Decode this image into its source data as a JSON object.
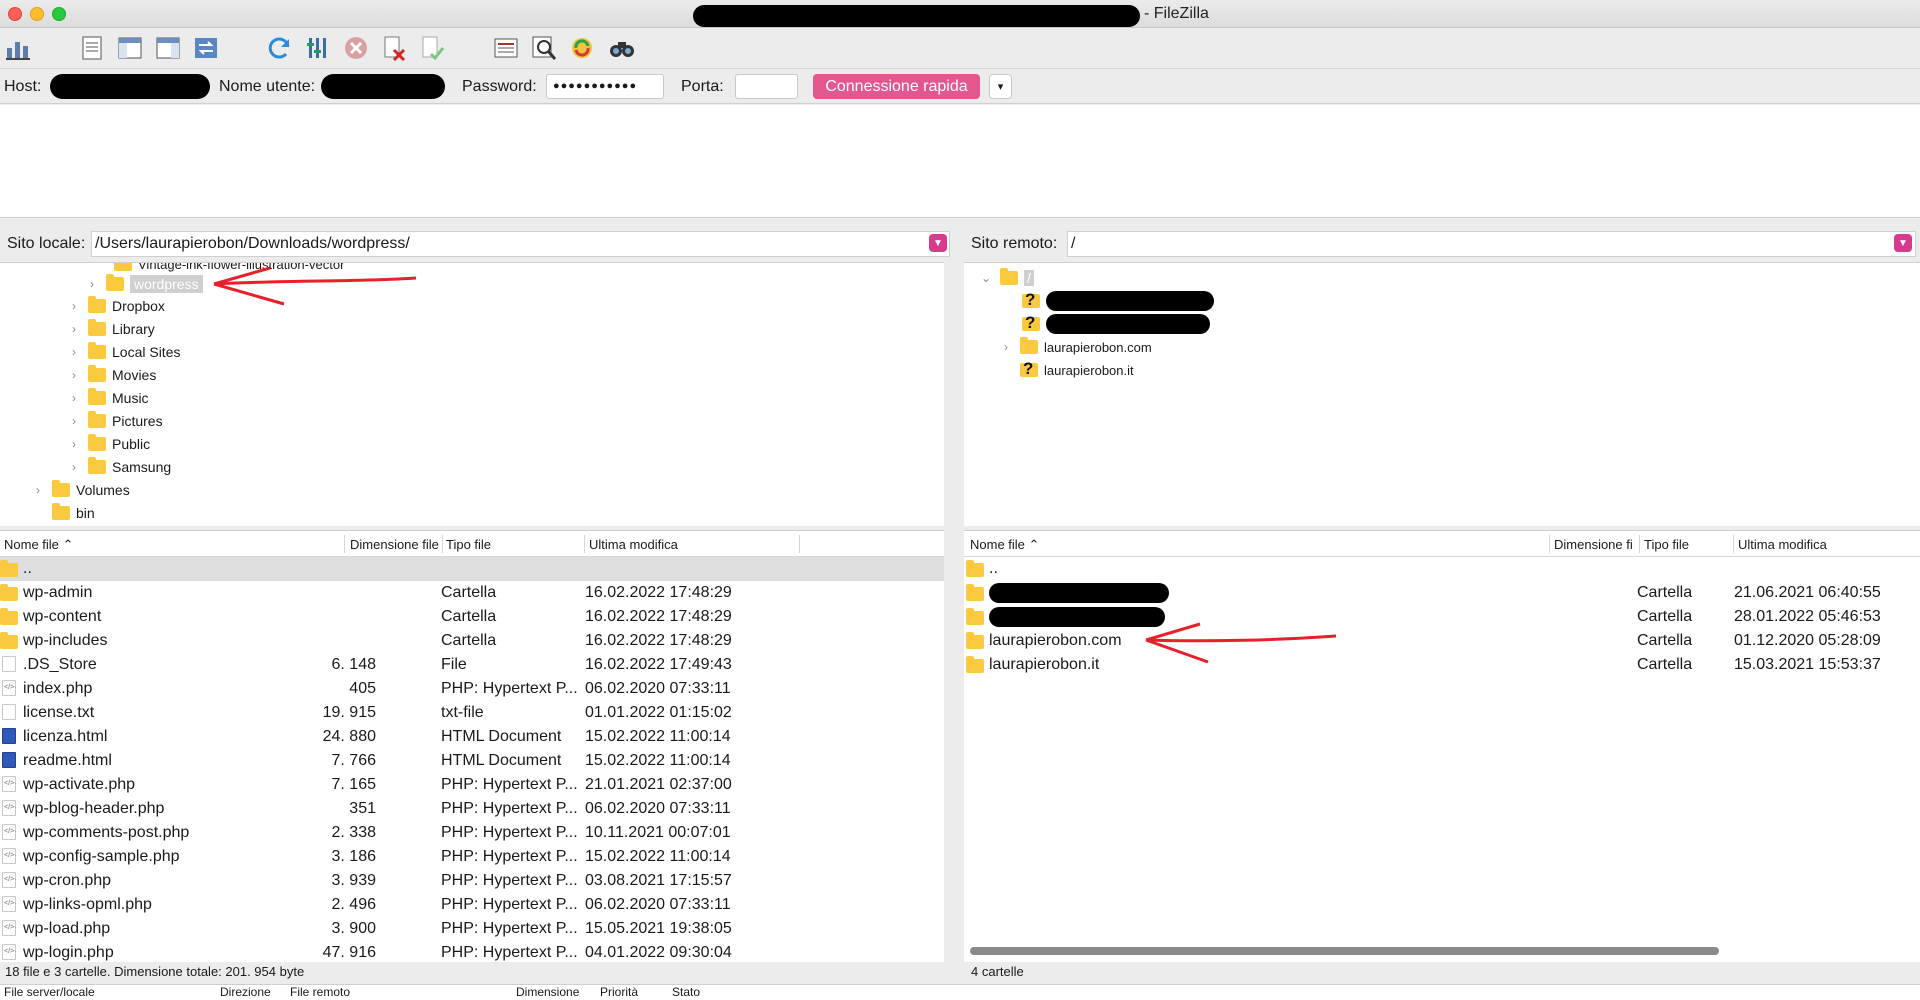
{
  "window": {
    "title": "- FileZilla"
  },
  "toolbar": {
    "icons": [
      "site-manager-icon",
      "message-log-icon",
      "local-tree-icon",
      "remote-tree-icon",
      "transfer-queue-icon",
      "refresh-icon",
      "process-queue-icon",
      "cancel-icon",
      "disconnect-icon",
      "reconnect-icon",
      "dir-listing-filter-icon",
      "toggle-sync-browse-icon",
      "compare-dirs-icon",
      "search-icon"
    ]
  },
  "quickconnect": {
    "host_label": "Host:",
    "user_label": "Nome utente:",
    "password_label": "Password:",
    "password_value": "●●●●●●●●●●●",
    "port_label": "Porta:",
    "port_value": "",
    "connect_button": "Connessione rapida",
    "dropdown_icon": "▾"
  },
  "local": {
    "site_label": "Sito locale:",
    "path": "/Users/laurapierobon/Downloads/wordpress/",
    "tree": [
      {
        "name": "Vintage-ink-flower-illustration-vector",
        "indent": 2,
        "chev": false
      },
      {
        "name": "wordpress",
        "indent": 2,
        "chev": true,
        "selected": true
      },
      {
        "name": "Dropbox",
        "indent": 1,
        "chev": true
      },
      {
        "name": "Library",
        "indent": 1,
        "chev": true
      },
      {
        "name": "Local Sites",
        "indent": 1,
        "chev": true
      },
      {
        "name": "Movies",
        "indent": 1,
        "chev": true
      },
      {
        "name": "Music",
        "indent": 1,
        "chev": true
      },
      {
        "name": "Pictures",
        "indent": 1,
        "chev": true
      },
      {
        "name": "Public",
        "indent": 1,
        "chev": true
      },
      {
        "name": "Samsung",
        "indent": 1,
        "chev": true
      },
      {
        "name": "Volumes",
        "indent": 0,
        "chev": true
      },
      {
        "name": "bin",
        "indent": 0,
        "chev": false
      }
    ],
    "columns": {
      "name": "Nome file",
      "size": "Dimensione file",
      "type": "Tipo file",
      "modified": "Ultima modifica"
    },
    "files": [
      {
        "name": "..",
        "size": "",
        "type": "",
        "modified": "",
        "icon": "folder"
      },
      {
        "name": "wp-admin",
        "size": "",
        "type": "Cartella",
        "modified": "16.02.2022 17:48:29",
        "icon": "folder"
      },
      {
        "name": "wp-content",
        "size": "",
        "type": "Cartella",
        "modified": "16.02.2022 17:48:29",
        "icon": "folder"
      },
      {
        "name": "wp-includes",
        "size": "",
        "type": "Cartella",
        "modified": "16.02.2022 17:48:29",
        "icon": "folder"
      },
      {
        "name": ".DS_Store",
        "size": "6. 148",
        "type": "File",
        "modified": "16.02.2022 17:49:43",
        "icon": "file"
      },
      {
        "name": "index.php",
        "size": "405",
        "type": "PHP: Hypertext P...",
        "modified": "06.02.2020 07:33:11",
        "icon": "php"
      },
      {
        "name": "license.txt",
        "size": "19. 915",
        "type": "txt-file",
        "modified": "01.01.2022 01:15:02",
        "icon": "file"
      },
      {
        "name": "licenza.html",
        "size": "24. 880",
        "type": "HTML Document",
        "modified": "15.02.2022 11:00:14",
        "icon": "html"
      },
      {
        "name": "readme.html",
        "size": "7. 766",
        "type": "HTML Document",
        "modified": "15.02.2022 11:00:14",
        "icon": "html"
      },
      {
        "name": "wp-activate.php",
        "size": "7. 165",
        "type": "PHP: Hypertext P...",
        "modified": "21.01.2021 02:37:00",
        "icon": "php"
      },
      {
        "name": "wp-blog-header.php",
        "size": "351",
        "type": "PHP: Hypertext P...",
        "modified": "06.02.2020 07:33:11",
        "icon": "php"
      },
      {
        "name": "wp-comments-post.php",
        "size": "2. 338",
        "type": "PHP: Hypertext P...",
        "modified": "10.11.2021 00:07:01",
        "icon": "php"
      },
      {
        "name": "wp-config-sample.php",
        "size": "3. 186",
        "type": "PHP: Hypertext P...",
        "modified": "15.02.2022 11:00:14",
        "icon": "php"
      },
      {
        "name": "wp-cron.php",
        "size": "3. 939",
        "type": "PHP: Hypertext P...",
        "modified": "03.08.2021 17:15:57",
        "icon": "php"
      },
      {
        "name": "wp-links-opml.php",
        "size": "2. 496",
        "type": "PHP: Hypertext P...",
        "modified": "06.02.2020 07:33:11",
        "icon": "php"
      },
      {
        "name": "wp-load.php",
        "size": "3. 900",
        "type": "PHP: Hypertext P...",
        "modified": "15.05.2021 19:38:05",
        "icon": "php"
      },
      {
        "name": "wp-login.php",
        "size": "47. 916",
        "type": "PHP: Hypertext P...",
        "modified": "04.01.2022 09:30:04",
        "icon": "php"
      }
    ],
    "status": "18 file e 3 cartelle. Dimensione totale: 201. 954 byte"
  },
  "remote": {
    "site_label": "Sito remoto:",
    "path": "/",
    "tree": [
      {
        "name": "/",
        "type": "root"
      },
      {
        "name": "",
        "type": "unknown-redacted"
      },
      {
        "name": "",
        "type": "unknown-redacted"
      },
      {
        "name": "laurapierobon.com",
        "type": "folder"
      },
      {
        "name": "laurapierobon.it",
        "type": "unknown"
      }
    ],
    "columns": {
      "name": "Nome file",
      "size": "Dimensione fi",
      "type": "Tipo file",
      "modified": "Ultima modifica"
    },
    "files": [
      {
        "name": "..",
        "type": "",
        "modified": "",
        "redacted": false
      },
      {
        "name": "",
        "type": "Cartella",
        "modified": "21.06.2021 06:40:55",
        "redacted": true
      },
      {
        "name": "",
        "type": "Cartella",
        "modified": "28.01.2022 05:46:53",
        "redacted": true
      },
      {
        "name": "laurapierobon.com",
        "type": "Cartella",
        "modified": "01.12.2020 05:28:09",
        "redacted": false
      },
      {
        "name": "laurapierobon.it",
        "type": "Cartella",
        "modified": "15.03.2021 15:53:37",
        "redacted": false
      }
    ],
    "status": "4 cartelle"
  },
  "queue_columns": [
    "File server/locale",
    "Direzione",
    "File remoto",
    "Dimensione",
    "Priorità",
    "Stato"
  ],
  "colors": {
    "accent": "#e3578f",
    "folder": "#fbc93d",
    "annotation": "#e8202a"
  }
}
